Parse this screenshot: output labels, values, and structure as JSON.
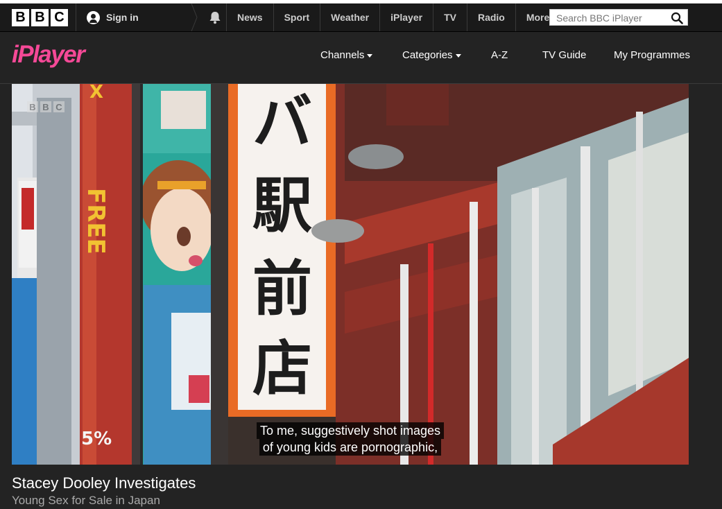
{
  "global_nav": {
    "logo_letters": [
      "B",
      "B",
      "C"
    ],
    "sign_in": "Sign in",
    "items": [
      "News",
      "Sport",
      "Weather",
      "iPlayer",
      "TV",
      "Radio",
      "More"
    ],
    "search_placeholder": "Search BBC iPlayer"
  },
  "iplayer_nav": {
    "logo": "iPlayer",
    "items": [
      "Channels",
      "Categories",
      "A-Z",
      "TV Guide",
      "My Programmes"
    ]
  },
  "video": {
    "channel_ident": "BBC",
    "sign_text": "バ駅前店",
    "side_sign": "FREE",
    "subtitle_lines": [
      "To me, suggestively shot images",
      "of young kids are pornographic,"
    ]
  },
  "programme": {
    "title": "Stacey Dooley Investigates",
    "episode": "Young Sex for Sale in Japan"
  },
  "colors": {
    "brand_pink": "#f54997",
    "page_bg": "#232323",
    "global_bar": "#1a1a1a"
  }
}
